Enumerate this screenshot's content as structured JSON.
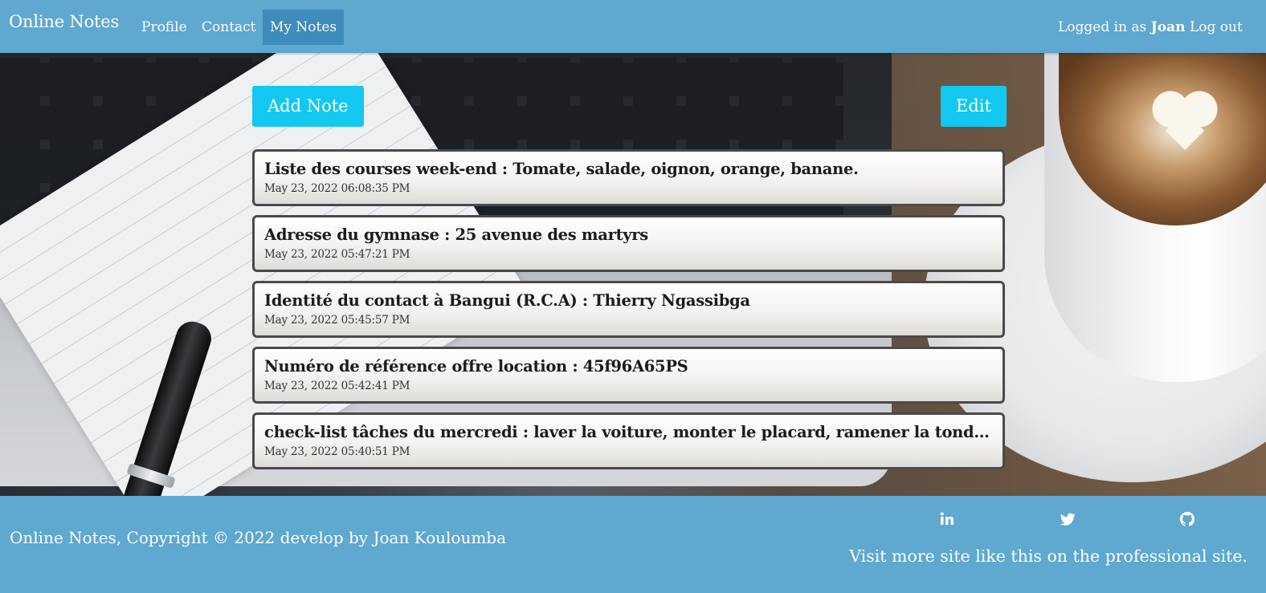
{
  "navbar": {
    "brand": "Online Notes",
    "links": [
      "Profile",
      "Contact",
      "My Notes"
    ],
    "active_link": "My Notes",
    "logged_in_prefix": "Logged in as",
    "username": "Joan",
    "logout_label": "Log out",
    "background_color": "#5fa8d0",
    "active_color": "#3d8cbb"
  },
  "actions": {
    "add_note_label": "Add Note",
    "edit_label": "Edit",
    "button_color": "#13c8f0"
  },
  "notes": [
    {
      "title": "Liste des courses week-end : Tomate, salade, oignon, orange, banane.",
      "date": "May 23, 2022 06:08:35 PM"
    },
    {
      "title": "Adresse du gymnase : 25 avenue des martyrs",
      "date": "May 23, 2022 05:47:21 PM"
    },
    {
      "title": "Identité du contact à Bangui (R.C.A) : Thierry Ngassibga",
      "date": "May 23, 2022 05:45:57 PM"
    },
    {
      "title": "Numéro de référence offre location : 45f96A65PS",
      "date": "May 23, 2022 05:42:41 PM"
    },
    {
      "title": "check-list tâches du mercredi : laver la voiture, monter le placard, ramener la tondeuse",
      "date": "May 23, 2022 05:40:51 PM"
    }
  ],
  "footer": {
    "copyright": "Online Notes, Copyright © 2022 develop by Joan Kouloumba",
    "social_icons": [
      "linkedin-icon",
      "twitter-icon",
      "github-icon"
    ],
    "visit_text": "Visit more site like this on the professional site."
  }
}
